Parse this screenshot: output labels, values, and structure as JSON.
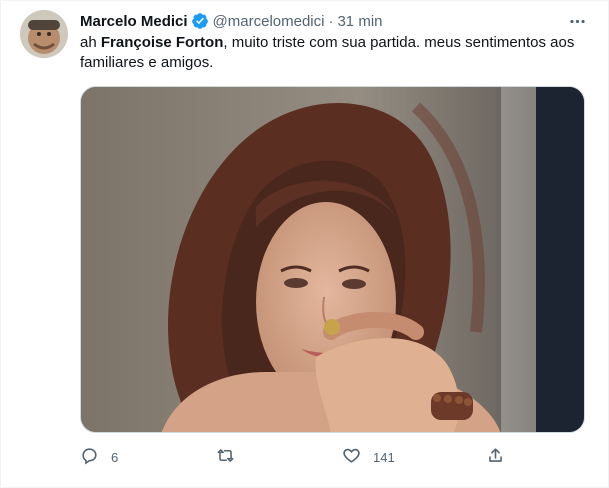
{
  "tweet": {
    "author_name": "Marcelo Medici",
    "handle": "@marcelomedici",
    "separator": "·",
    "time": "31 min",
    "text_prefix": "ah ",
    "text_mention": "Françoise Forton",
    "text_suffix": ", muito triste com sua partida. meus sentimentos aos familiares e amigos.",
    "verified_icon": "verified-badge-icon",
    "more_icon": "more-icon"
  },
  "actions": {
    "reply_count": "6",
    "retweet_count": "",
    "like_count": "141",
    "share_count": ""
  },
  "colors": {
    "text": "#0f1419",
    "secondary": "#536471",
    "verified": "#1d9bf0",
    "border": "#cfd9de"
  }
}
